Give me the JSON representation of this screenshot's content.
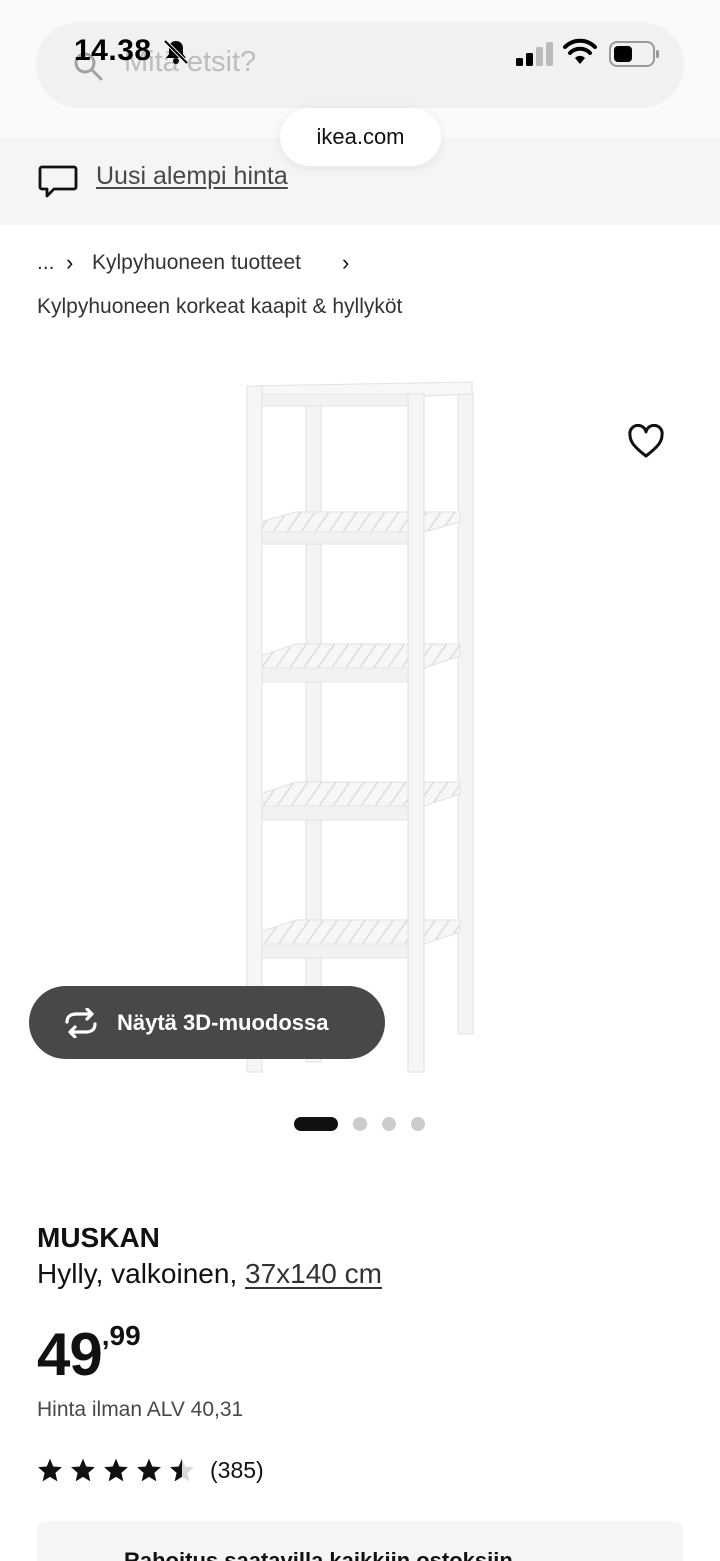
{
  "status_bar": {
    "time": "14.38"
  },
  "search": {
    "placeholder": "Mitä etsit?"
  },
  "browser": {
    "url": "ikea.com"
  },
  "banner": {
    "link_text": "Uusi alempi hinta"
  },
  "breadcrumb": {
    "ellipsis": "...",
    "separator": "›",
    "parent": "Kylpyhuoneen tuotteet",
    "current": "Kylpyhuoneen korkeat kaapit & hyllyköt"
  },
  "gallery": {
    "view_3d_label": "Näytä 3D-muodossa",
    "slide_count": 4,
    "active_slide": 1
  },
  "product": {
    "name": "MUSKAN",
    "description": "Hylly, valkoinen,",
    "size": "37x140 cm",
    "price_integer": "49",
    "price_decimal": ",99",
    "vat_text": "Hinta ilman ALV 40,31",
    "rating": 4.5,
    "rating_max": 5,
    "review_count": "(385)"
  },
  "finance": {
    "text": "Rahoitus saatavilla kaikkiin ostoksiin"
  },
  "colors": {
    "button_dark": "#484848",
    "text": "#111111",
    "banner_bg": "#f5f5f5"
  }
}
